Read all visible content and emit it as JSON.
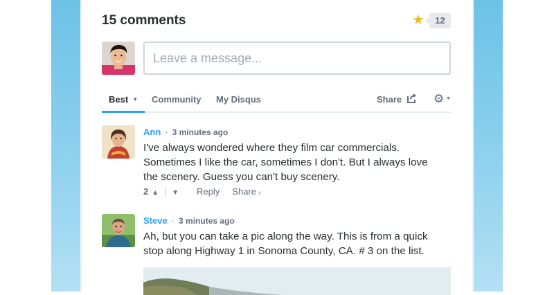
{
  "header": {
    "comments_count": "15 comments",
    "favorite_count": "12"
  },
  "composer": {
    "placeholder": "Leave a message..."
  },
  "nav": {
    "tabs": [
      {
        "label": "Best"
      },
      {
        "label": "Community"
      },
      {
        "label": "My Disqus"
      }
    ],
    "share_label": "Share"
  },
  "comments": [
    {
      "author": "Ann",
      "time": "3 minutes ago",
      "text": "I've always wondered where they film car commercials. Sometimes I like the car, sometimes I don't. But I always love the scenery. Guess you can't buy scenery.",
      "votes": "2",
      "reply_label": "Reply",
      "share_label": "Share"
    },
    {
      "author": "Steve",
      "time": "3 minutes ago",
      "text": "Ah, but you can take a pic along the way. This is from a quick stop along Highway 1 in Sonoma County, CA. # 3 on the list."
    }
  ],
  "colors": {
    "accent": "#2e9fff",
    "background_side": "#8fd1ee",
    "star": "#f2b824",
    "text": "#2a2e2e",
    "muted": "#656c7a"
  },
  "icons": [
    "star-icon",
    "share-icon",
    "gear-icon",
    "caret-down-icon",
    "upvote-icon",
    "downvote-icon",
    "chevron-right-icon"
  ]
}
